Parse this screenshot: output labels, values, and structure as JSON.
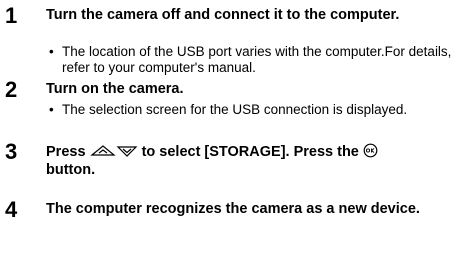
{
  "steps": [
    {
      "number": "1",
      "title": "Turn the camera off and connect it to the computer.",
      "bullets": [
        "The location of the USB port varies with the computer.For details, refer to your computer's manual."
      ]
    },
    {
      "number": "2",
      "title": "Turn on the camera.",
      "bullets": [
        "The selection screen for the USB connection is displayed."
      ]
    },
    {
      "number": "3",
      "title_before_arrows": "Press",
      "title_after_arrows": "to select [STORAGE]. Press the",
      "title_after_ok": "button.",
      "icons": [
        "up-arrow-button-icon",
        "down-arrow-button-icon",
        "ok-button-icon"
      ]
    },
    {
      "number": "4",
      "title": "The computer recognizes the camera as a new device."
    }
  ],
  "bullet_glyph": "•"
}
